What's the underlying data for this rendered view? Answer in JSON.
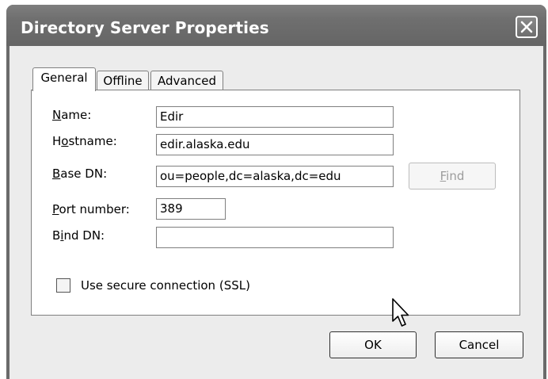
{
  "window": {
    "title": "Directory Server Properties"
  },
  "tabs": [
    {
      "label": "General",
      "active": true
    },
    {
      "label": "Offline",
      "active": false
    },
    {
      "label": "Advanced",
      "active": false
    }
  ],
  "form": {
    "name": {
      "label_pre": "",
      "label_key": "N",
      "label_post": "ame:",
      "value": "Edir"
    },
    "hostname": {
      "label_pre": "H",
      "label_key": "o",
      "label_post": "stname:",
      "value": "edir.alaska.edu"
    },
    "base_dn": {
      "label_pre": "",
      "label_key": "B",
      "label_post": "ase DN:",
      "value": "ou=people,dc=alaska,dc=edu"
    },
    "port": {
      "label_pre": "",
      "label_key": "P",
      "label_post": "ort number:",
      "value": "389"
    },
    "bind_dn": {
      "label_pre": "B",
      "label_key": "i",
      "label_post": "nd DN:",
      "value": ""
    },
    "find_button": {
      "label_key": "F",
      "label_post": "ind"
    },
    "ssl": {
      "label": "Use secure connection (SSL)",
      "checked": false
    }
  },
  "buttons": {
    "ok": "OK",
    "cancel": "Cancel"
  },
  "icons": {
    "close": "close-icon",
    "cursor": "mouse-cursor-icon"
  }
}
